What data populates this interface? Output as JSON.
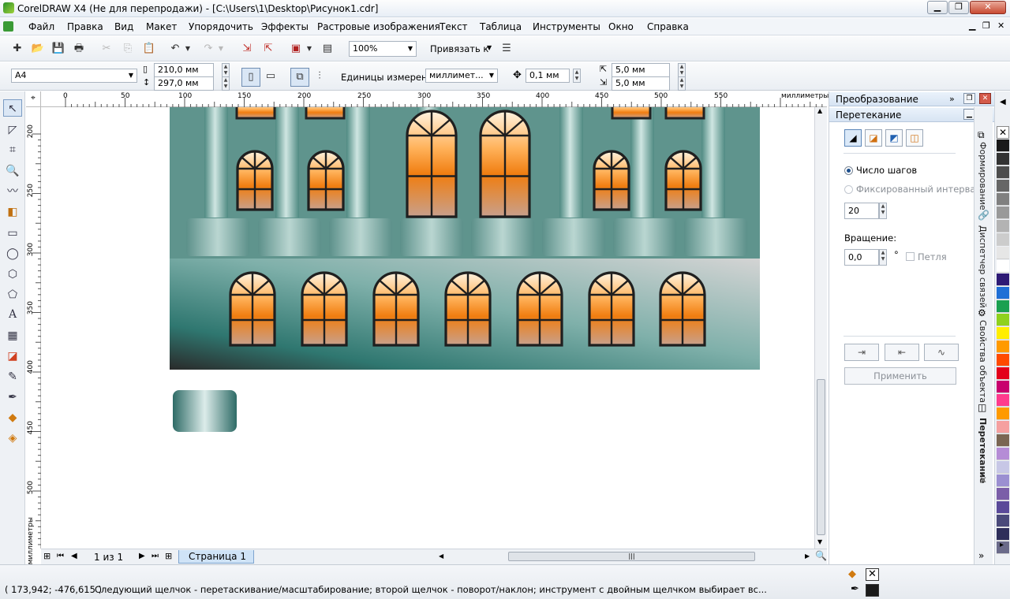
{
  "window": {
    "title": "CorelDRAW X4 (Не для перепродажи) - [C:\\Users\\1\\Desktop\\Рисунок1.cdr]"
  },
  "menu": [
    "Файл",
    "Правка",
    "Вид",
    "Макет",
    "Упорядочить",
    "Эффекты",
    "Растровые изображения",
    "Текст",
    "Таблица",
    "Инструменты",
    "Окно",
    "Справка"
  ],
  "toolbar": {
    "zoom": "100%",
    "snap_label": "Привязать к"
  },
  "property_bar": {
    "page_size": "A4",
    "width": "210,0 мм",
    "height": "297,0 мм",
    "units_label": "Единицы измерения:",
    "units_value": "миллимет...",
    "nudge": "0,1 мм",
    "dup_x": "5,0 мм",
    "dup_y": "5,0 мм"
  },
  "ruler": {
    "top_ticks": [
      "0",
      "50",
      "100",
      "150",
      "200",
      "250",
      "300",
      "350",
      "400",
      "450",
      "500",
      "550"
    ],
    "top_unit": "миллиметры",
    "left_ticks": [
      "200",
      "250",
      "300",
      "350",
      "400",
      "450",
      "500"
    ],
    "left_unit": "миллиметры"
  },
  "pages": {
    "counter": "1 из 1",
    "tab": "Страница 1"
  },
  "docker": {
    "panel1_title": "Преобразование",
    "panel2_title": "Перетекание",
    "steps_label": "Число шагов",
    "fixed_label": "Фиксированный интервал",
    "steps_value": "20",
    "rotation_label": "Вращение:",
    "rotation_value": "0,0",
    "degree": "°",
    "loop_label": "Петля",
    "apply": "Применить"
  },
  "side_tabs": [
    "Формирование",
    "Диспетчер связей",
    "Свойства объекта",
    "Перетекание"
  ],
  "palette": [
    "#1a1a1a",
    "#333333",
    "#4d4d4d",
    "#666666",
    "#808080",
    "#999999",
    "#b3b3b3",
    "#cccccc",
    "#e6e6e6",
    "#ffffff",
    "#2e1a75",
    "#1f6fd6",
    "#1aa050",
    "#8fd11e",
    "#ffee00",
    "#ff9a00",
    "#ff4a00",
    "#e3001b",
    "#c8006e",
    "#ff3b8d",
    "#ff9a00",
    "#f5a0a0",
    "#7a6653",
    "#b58cd6",
    "#c7c7e6",
    "#9b8fd1",
    "#7b5ea8",
    "#5a4a99",
    "#4a4a7a",
    "#2e2e5a",
    "#6b6b8a"
  ],
  "status": {
    "coords": "( 173,942; -476,615 )",
    "hint": "Следующий щелчок - перетаскивание/масштабирование; второй щелчок - поворот/наклон; инструмент с двойным щелчком выбирает вс..."
  }
}
